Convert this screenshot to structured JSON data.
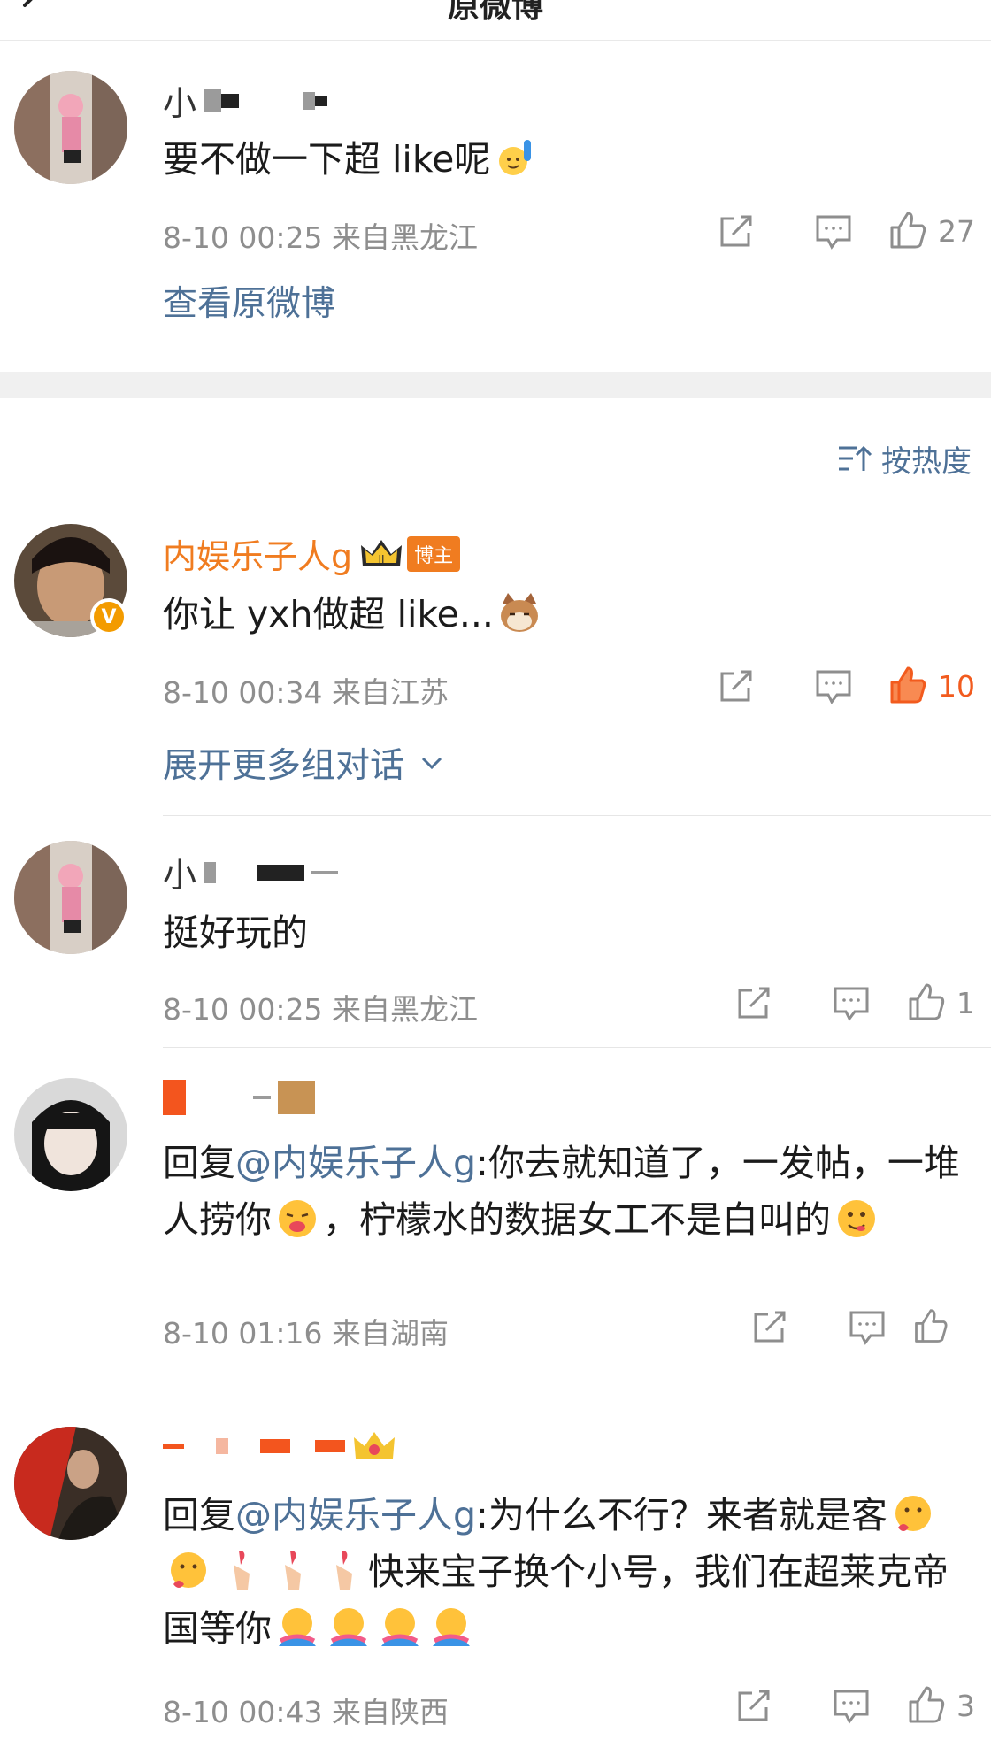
{
  "header": {
    "title": "原微博"
  },
  "sort": {
    "label": "按热度"
  },
  "original": {
    "username": "小",
    "text": "要不做一下超 like呢",
    "time": "8-10 00:25",
    "location": "来自黑龙江",
    "likes": "27",
    "view_original": "查看原微博"
  },
  "comments": [
    {
      "username": "内娱乐子人g",
      "badge": "博主",
      "text": "你让 yxh做超 like...",
      "time": "8-10 00:34",
      "location": "来自江苏",
      "likes": "10",
      "expand": "展开更多组对话"
    },
    {
      "username": "小",
      "text": "挺好玩的",
      "time": "8-10 00:25",
      "location": "来自黑龙江",
      "likes": "1"
    },
    {
      "reply_prefix": "回复",
      "mention": "@内娱乐子人g",
      "text_part1": ":你去就知道了，一发帖，一堆人捞你",
      "text_part2": "，柠檬水的数据女工不是白叫的",
      "time": "8-10 01:16",
      "location": "来自湖南",
      "likes": ""
    },
    {
      "reply_prefix": "回复",
      "mention": "@内娱乐子人g",
      "text_part1": ":为什么不行？来者就是客",
      "text_part2": "快来宝子换个小号，我们在超莱克帝国等你",
      "time": "8-10 00:43",
      "location": "来自陕西",
      "likes": "3"
    }
  ],
  "colors": {
    "link": "#4e7197",
    "orange": "#f07c20",
    "like_active": "#f25b1e",
    "meta": "#8e8e8e"
  }
}
